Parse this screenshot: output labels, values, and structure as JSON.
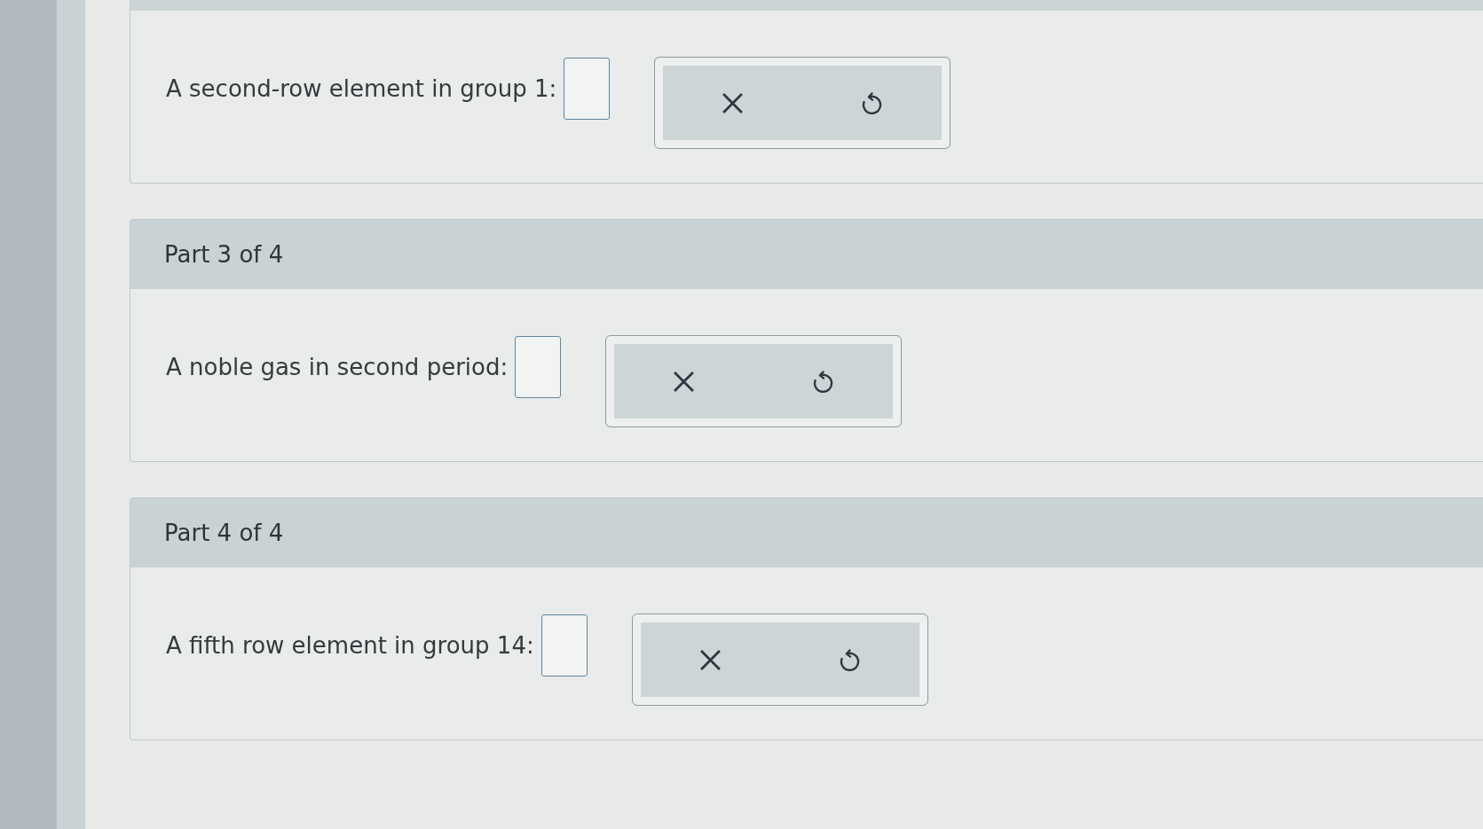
{
  "parts": [
    {
      "question": "A second-row element in group 1:"
    },
    {
      "title": "Part 3 of 4",
      "question": "A noble gas in second period:"
    },
    {
      "title": "Part 4 of 4",
      "question": "A fifth row element in group 14:"
    }
  ]
}
